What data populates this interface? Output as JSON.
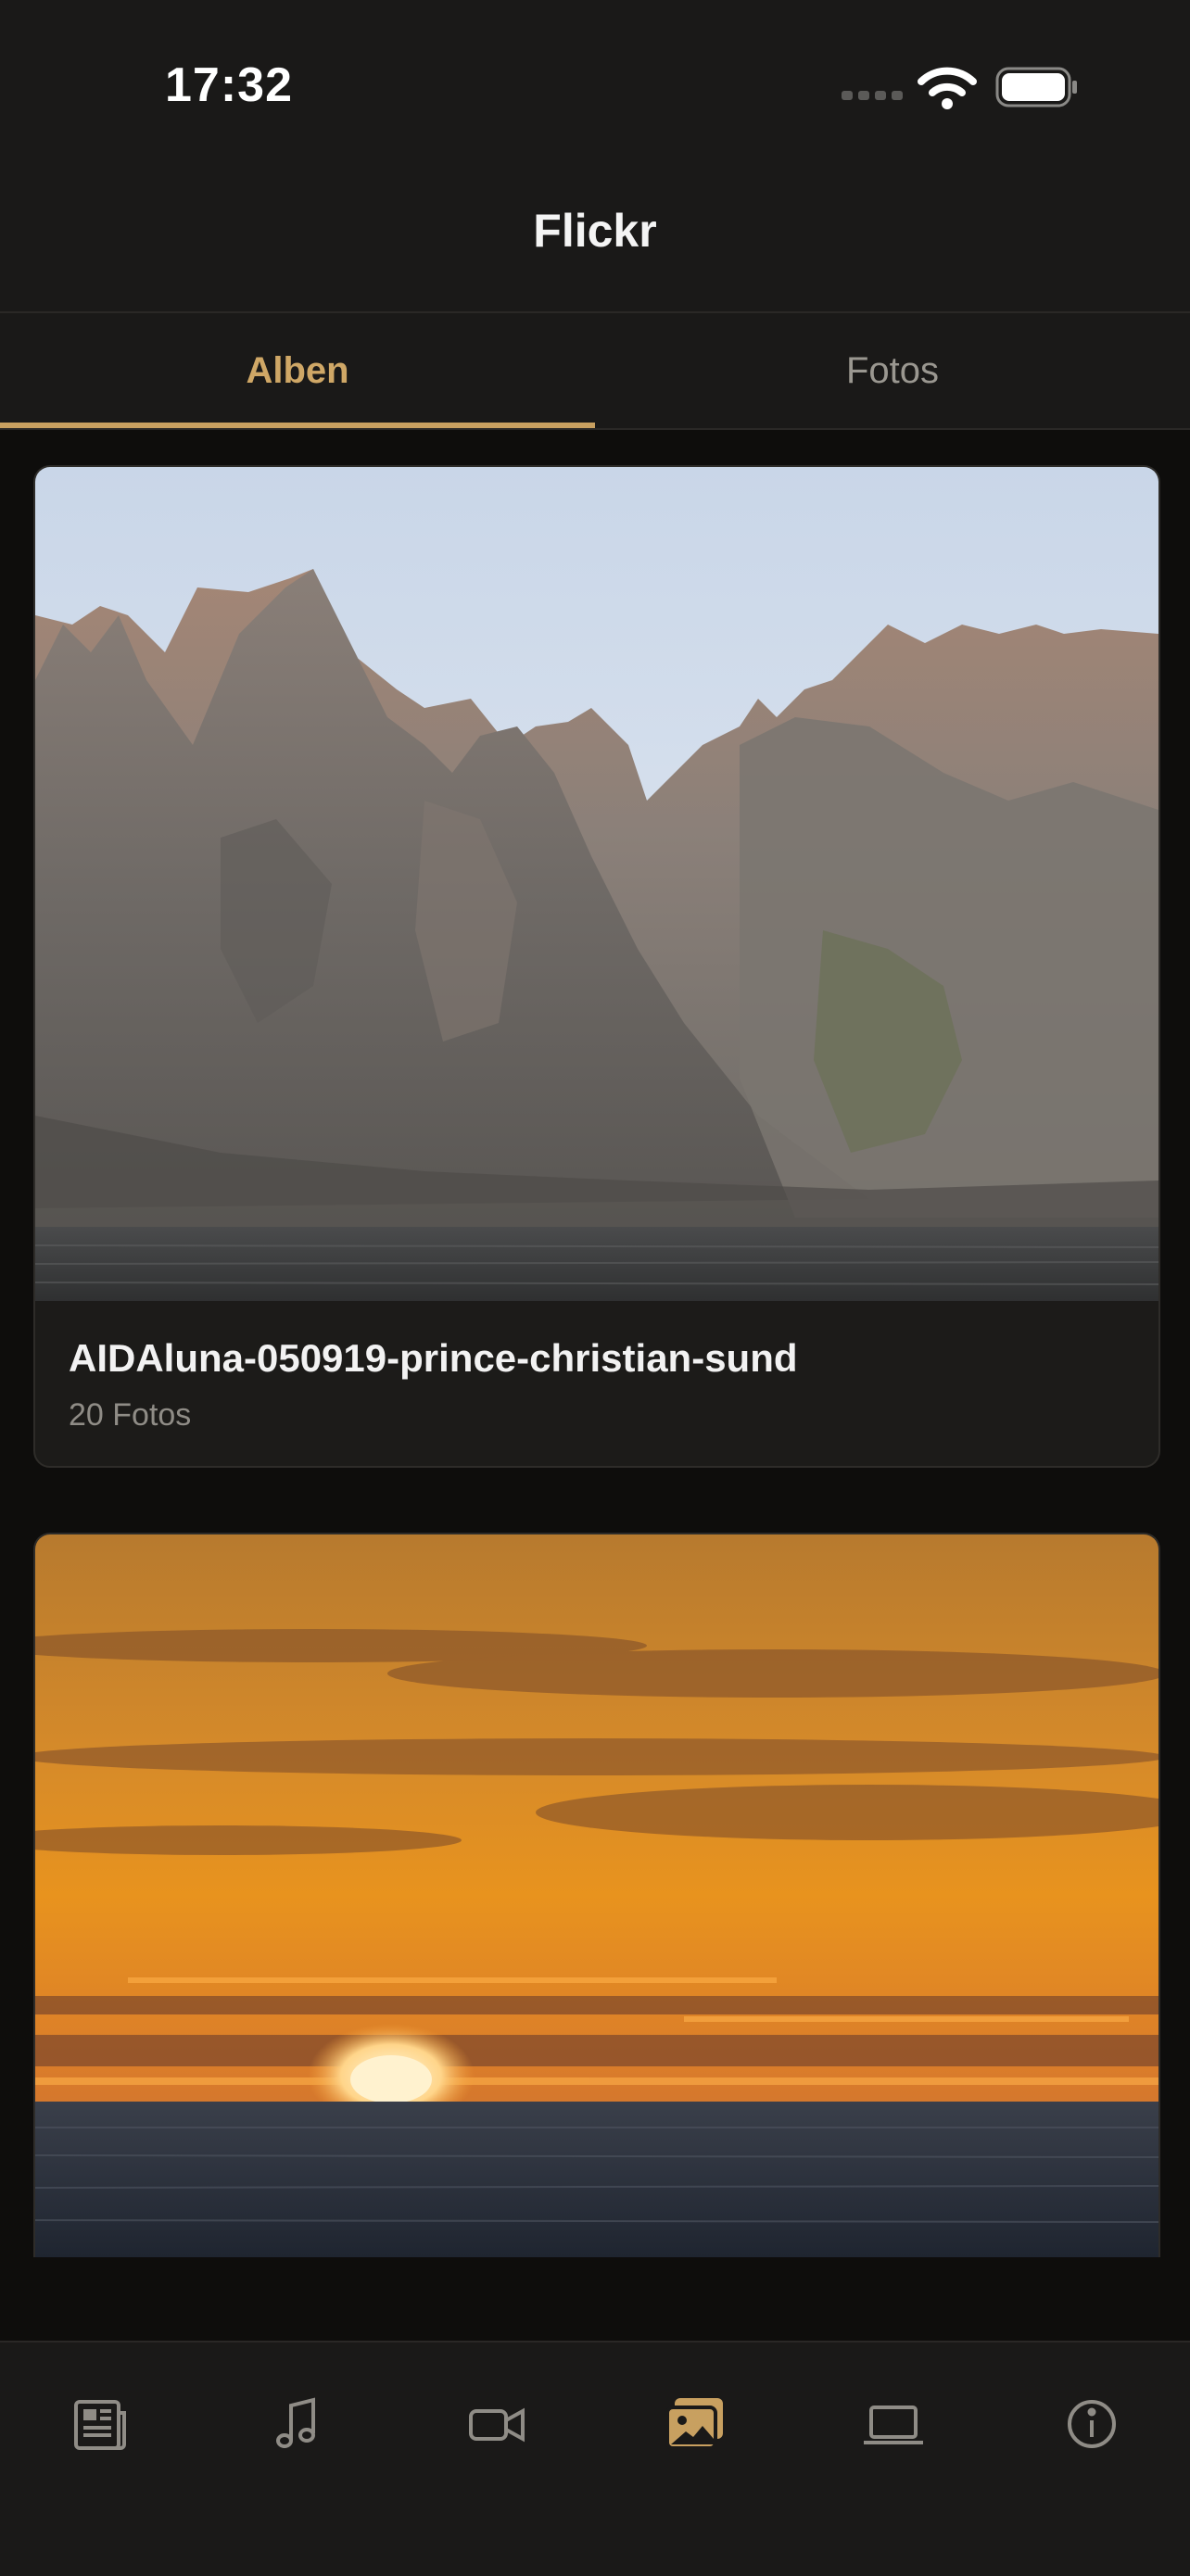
{
  "status_bar": {
    "time": "17:32"
  },
  "nav": {
    "title": "Flickr"
  },
  "tabs": [
    {
      "label": "Alben",
      "selected": true
    },
    {
      "label": "Fotos",
      "selected": false
    }
  ],
  "albums": [
    {
      "title": "AIDAluna-050919-prince-christian-sund",
      "count": "20 Fotos",
      "image": "mountain-fjord-photo"
    },
    {
      "title": "",
      "count": "",
      "image": "sunset-sea-photo"
    }
  ],
  "tab_bar": [
    {
      "icon": "news-icon",
      "selected": false
    },
    {
      "icon": "music-icon",
      "selected": false
    },
    {
      "icon": "video-icon",
      "selected": false
    },
    {
      "icon": "photos-icon",
      "selected": true
    },
    {
      "icon": "laptop-icon",
      "selected": false
    },
    {
      "icon": "info-icon",
      "selected": false
    }
  ],
  "colors": {
    "accent": "#c8a060",
    "background": "#0e0d0c",
    "bar": "#1a1918",
    "inactive": "#8f8c86"
  }
}
